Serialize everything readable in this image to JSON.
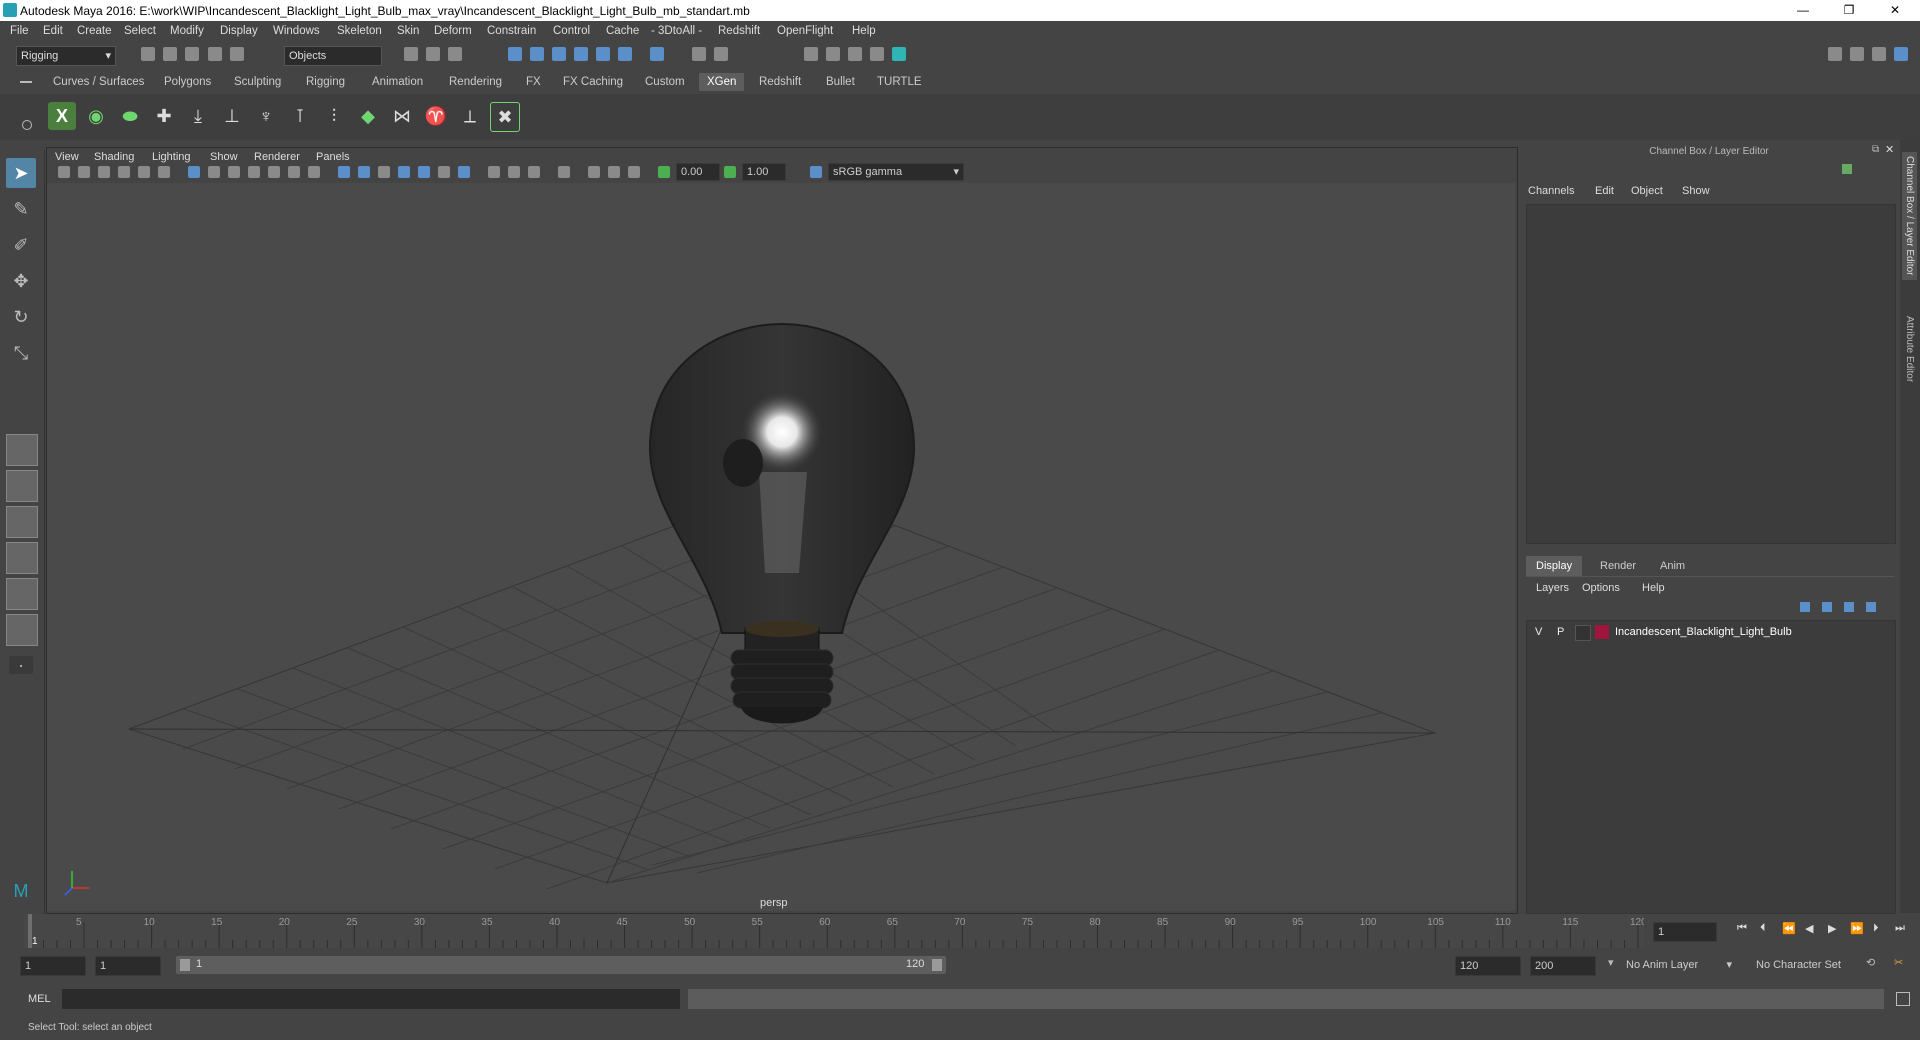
{
  "titlebar": {
    "title": "Autodesk Maya 2016: E:\\work\\WIP\\Incandescent_Blacklight_Light_Bulb_max_vray\\Incandescent_Blacklight_Light_Bulb_mb_standart.mb",
    "minimize": "—",
    "restore": "❐",
    "close": "✕"
  },
  "menubar": [
    "File",
    "Edit",
    "Create",
    "Select",
    "Modify",
    "Display",
    "Windows",
    "Skeleton",
    "Skin",
    "Deform",
    "Constrain",
    "Control",
    "Cache",
    "- 3DtoAll -",
    "Redshift",
    "OpenFlight",
    "Help"
  ],
  "statusline": {
    "mode": "Rigging",
    "selection_mode": "Objects"
  },
  "shelf_tabs": [
    "Curves / Surfaces",
    "Polygons",
    "Sculpting",
    "Rigging",
    "Animation",
    "Rendering",
    "FX",
    "FX Caching",
    "Custom",
    "XGen",
    "Redshift",
    "Bullet",
    "TURTLE"
  ],
  "shelf_active": "XGen",
  "viewport": {
    "menu": [
      "View",
      "Shading",
      "Lighting",
      "Show",
      "Renderer",
      "Panels"
    ],
    "exposure": "0.00",
    "gamma": "1.00",
    "colorspace": "sRGB gamma",
    "camera": "persp"
  },
  "channelbox": {
    "title": "Channel Box / Layer Editor",
    "menu": [
      "Channels",
      "Edit",
      "Object",
      "Show"
    ]
  },
  "layer_editor": {
    "tabs": [
      "Display",
      "Render",
      "Anim"
    ],
    "active_tab": "Display",
    "menu": [
      "Layers",
      "Options",
      "Help"
    ],
    "layers": [
      {
        "v": "V",
        "p": "P",
        "name": "Incandescent_Blacklight_Light_Bulb",
        "color": "#a0153e"
      }
    ]
  },
  "side_tabs": [
    "Channel Box / Layer Editor",
    "Attribute Editor"
  ],
  "timeline": {
    "ticks": [
      "1",
      "5",
      "10",
      "15",
      "20",
      "25",
      "30",
      "35",
      "40",
      "45",
      "50",
      "55",
      "60",
      "65",
      "70",
      "75",
      "80",
      "85",
      "90",
      "95",
      "100",
      "105",
      "110",
      "115",
      "120"
    ],
    "current_frame": "1"
  },
  "range": {
    "start": "1",
    "playback_start": "1",
    "slider_start": "1",
    "slider_end": "120",
    "playback_end": "120",
    "end": "200",
    "anim_layer": "No Anim Layer",
    "character_set": "No Character Set"
  },
  "cmdline": {
    "label": "MEL"
  },
  "helpline": {
    "text": "Select Tool: select an object"
  },
  "colors": {
    "accent": "#5285a6",
    "layer_color": "#a0153e"
  }
}
